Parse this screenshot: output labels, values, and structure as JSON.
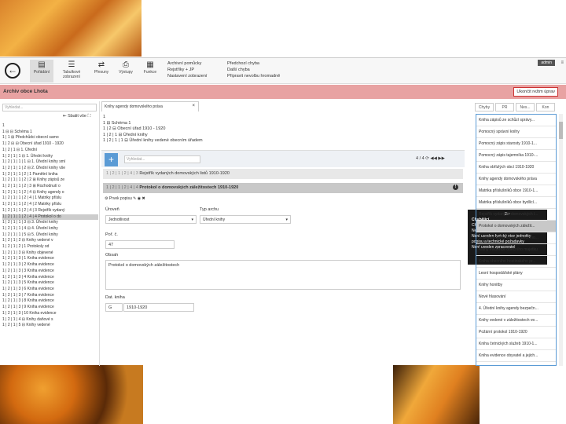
{
  "toolbar": {
    "buttons": [
      {
        "label": "Pořádání",
        "icon": "tree-icon"
      },
      {
        "label": "Tabulkové zobrazení",
        "icon": "table-icon"
      },
      {
        "label": "Přesuny",
        "icon": "arrows-icon"
      },
      {
        "label": "Výstupy",
        "icon": "printer-icon"
      },
      {
        "label": "Funkce",
        "icon": "calculator-icon"
      }
    ],
    "menu_col1": [
      "Archivní pomůcky",
      "Rejstříky + JP",
      "Nastavení zobrazení"
    ],
    "menu_col2": [
      "Předchozí chyba",
      "Další chyba",
      "Připravit nevolbu hromadně"
    ],
    "user": "admin",
    "user_menu": "≡"
  },
  "header": {
    "title": "Archiv obce Lhota",
    "end_button": "Ukončit režim úprav"
  },
  "left": {
    "search_placeholder": "Vyhledat...",
    "collapse_label": "Sbalit vše",
    "tree": [
      "1",
      "1 ⊟ ⊟ Schéma 1",
      "1 | 1 ⊞ Předchůdci obecní samo",
      "1 | 2 ⊟ ⊟ Obecní úřad 1910 - 1920",
      "1 | 2 | 1 ⊟ 1. Úřední",
      "1 | 2 | 1 | 1 ⊟ 1. Úřední knihy",
      "1 | 2 | 1 | 1 | 1 ⊟ 1. Úřední knihy smí",
      "1 | 2 | 1 | 1 | 2 ⊟ 2. Úřední knihy vše",
      "1 | 2 | 1 | 1 | 2 | 1   Pamětní kniha",
      "1 | 2 | 1 | 1 | 2 | 2 ⊞ Knihy zápisů ze",
      "1 | 2 | 1 | 1 | 2 | 3 ⊞ Rozhodnutí o",
      "1 | 2 | 1 | 1 | 2 | 4 ⊟ Knihy agendy o",
      "1 | 2 | 1 | 1 | 2 | 4 | 1   Matriky příslu",
      "1 | 2 | 1 | 1 | 2 | 4 | 2   Matriky příslu",
      "1 | 2 | 1 | 1 | 2 | 4 | 3   Rejstřík vydaný",
      "1 | 2 | 1 | 1 | 2 | 4 | 4   Protokol o do",
      "1 | 2 | 1 | 1 | 3 ⊟ 3. Úřední knihy",
      "1 | 2 | 1 | 1 | 4 ⊟ 4. Úřední knihy",
      "1 | 2 | 1 | 1 | 5 ⊟ 5. Úřední knihy",
      "1 | 2 | 1 | 2 ⊟ Knihy vedené v",
      "1 | 2 | 1 | 2 | 1   Protokoly od",
      "1 | 2 | 1 | 3 ⊟ Knihy objevené",
      "1 | 2 | 1 | 3 | 1   Kniha evidence",
      "1 | 2 | 1 | 3 | 2   Kniha evidence",
      "1 | 2 | 1 | 3 | 3   Kniha evidence",
      "1 | 2 | 1 | 3 | 4   Kniha evidence",
      "1 | 2 | 1 | 3 | 5   Kniha evidence",
      "1 | 2 | 1 | 3 | 6   Kniha evidence",
      "1 | 2 | 1 | 3 | 7   Kniha evidence",
      "1 | 2 | 1 | 3 | 8   Kniha evidence",
      "1 | 2 | 1 | 3 | 9   Kniha evidence",
      "1 | 2 | 1 | 3 | 10   Kniha evidence",
      "1 | 2 | 1 | 4 ⊟ Knihy daňové s",
      "1 | 2 | 1 | 5 ⊟ Knihy vedené"
    ],
    "selected_index": 15
  },
  "center": {
    "tab_title": "Knihy agendy domovského práva",
    "tab_close": "×",
    "breadcrumb": [
      "1",
      "1 ⊟ Schéma 1",
      "1 | 2 ⊟ Obecní úřad 1910 - 1920",
      "1 | 2 | 1 ⊟ Úřední knihy",
      "1 | 2 | 1 | 1 ⊟ Úřední knihy vedené obecním úřadem"
    ],
    "search_placeholder": "Vyhledat...",
    "pager": "4 / 4",
    "records": [
      {
        "code": "1 | 2 | 1 | 2 | 4 | 3",
        "title": "Rejstřík vydaných domovských listů 1910-1920"
      },
      {
        "code": "1 | 2 | 1 | 2 | 4 | 4",
        "title": "Protokol o domovských záležitostech 1910-1920"
      }
    ],
    "form": {
      "toolbar_label": "Prvek popisu",
      "fields": {
        "level_label": "Úroveň",
        "level_value": "Jednotlivost",
        "type_label": "Typ archu",
        "type_value": "Úřední knihy",
        "order_label": "Poř. č.",
        "order_value": "47",
        "content_label": "Obsah",
        "content_value": "Protokol o domovských záležitostech",
        "date_label": "Dat. kniha",
        "date_prefix": "G",
        "date_value": "1910-1920"
      }
    },
    "error": {
      "title": "Err",
      "lines": [
        "Chybějící",
        "Chybí ukládací jednotka",
        "Nelze evidovat musí být připravení",
        "Není uveden fyzický stav jednotky",
        "popisu a technické požadavky",
        "Není uveden zpracovatel"
      ]
    }
  },
  "right": {
    "tabs": [
      "Chyby",
      "PR",
      "Nes...",
      "Kon"
    ],
    "items": [
      "Kniha zápisů ze schůzí správy...",
      "Pomocný správní knihy",
      "Pomocný zápis starosty 1910-1...",
      "Pomocný zápis tajemníka 1910-...",
      "Kniha obřízlých obcí 1910-1920",
      "Knihy agendy domovského práva",
      "Matrika příslušníků obce 1910-1...",
      "Matrika příslušníků obce bydlící...",
      "Rejstřík vydaných domovských l...",
      "Protokol o domovských záležit...",
      "3. Úřední knihy správy obecního...",
      "Knihy evidence obecního majetku",
      "Kniha obecního hostinského pr...",
      "Lesní hospodářské plány",
      "Knihy honitby",
      "Nové hlasování",
      "4. Úřední knihy agendy bezpečn...",
      "Knihy vedené v záležitostech ve...",
      "Požární protokol 1910-1920",
      "Kniha četnických služeb 1910-1...",
      "Kniha evidence obyvatel a jejich...",
      "Kniha evidence přistěhovalých cizin...",
      "Kniha evidence neslučitelných...",
      "Kniha hlášení pobytu osob 1910-..."
    ],
    "selected_index": 9
  }
}
